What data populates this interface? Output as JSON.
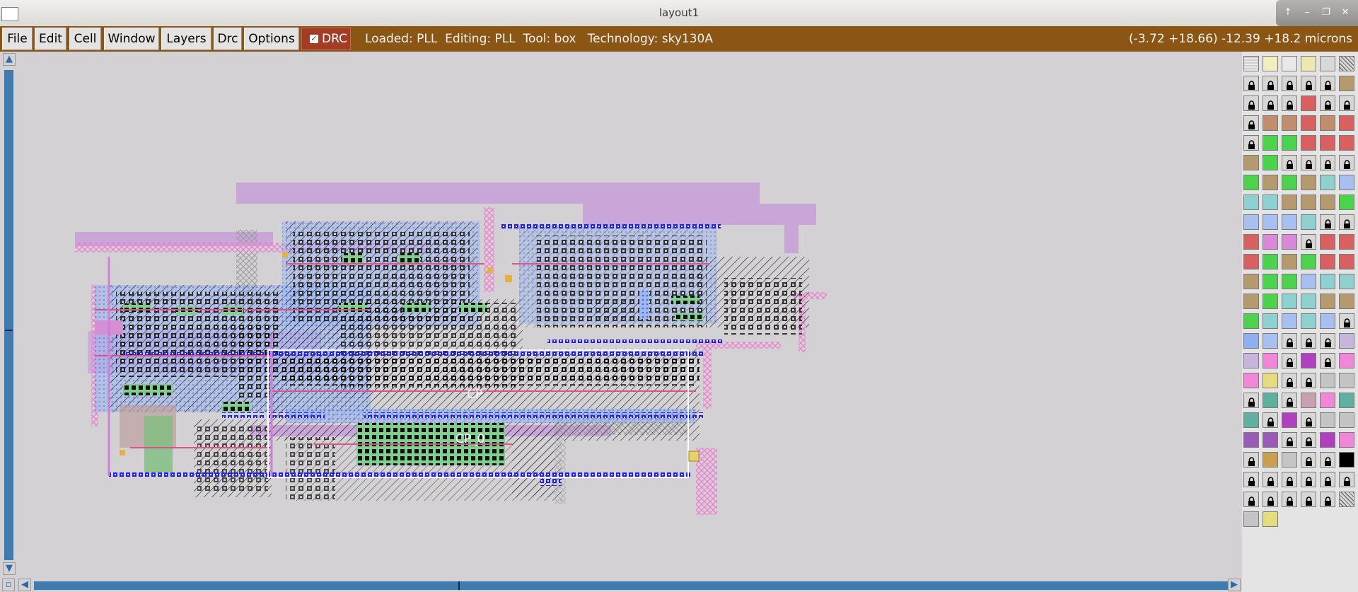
{
  "window": {
    "title": "layout1",
    "controls": [
      "up-icon",
      "minimize-icon",
      "restore-icon",
      "close-icon"
    ]
  },
  "menu": {
    "file": "File",
    "edit": "Edit",
    "cell": "Cell",
    "window": "Window",
    "layers": "Layers",
    "drc_menu": "Drc",
    "options": "Options"
  },
  "drc_toggle": {
    "label": "DRC",
    "checked": true
  },
  "status": {
    "text": "Loaded: PLL  Editing: PLL  Tool: box   Technology: sky130A"
  },
  "coords": {
    "text": "(-3.72 +18.66) -12.39 +18.2 microns"
  },
  "layout": {
    "cell_label": "CP",
    "instance_label": "CP_0"
  },
  "colors": {
    "menubar": "#8b5513",
    "drc": "#a33c27",
    "scroll": "#3f7bb0",
    "canvas": "#d3d1d4",
    "metal1": "#9ab4ea",
    "metal2": "#c8a0d8",
    "li": "#d07fd8",
    "poly": "#e04080",
    "diff": "#50c050",
    "via": "#2020e8"
  },
  "palette": {
    "layers": [
      "grid",
      "pwell",
      "box",
      "nwell",
      "outline",
      "hatch",
      "lock",
      "lock",
      "lock",
      "lock",
      "lock",
      "tan",
      "lock",
      "lock",
      "lock",
      "red",
      "lock",
      "lock",
      "lock",
      "brown",
      "brown",
      "red",
      "brown",
      "red",
      "lock",
      "green",
      "green",
      "red",
      "red",
      "red",
      "tan",
      "green",
      "lock",
      "lock",
      "lock",
      "lock",
      "green",
      "tan",
      "green",
      "tan",
      "cyan",
      "blue",
      "cyan",
      "cyan",
      "tan",
      "tan",
      "tan",
      "green",
      "blue",
      "blue",
      "blue",
      "cyan",
      "lock",
      "lock",
      "red",
      "magenta",
      "magenta",
      "lock",
      "red",
      "red",
      "red",
      "green",
      "tan",
      "green",
      "red",
      "red",
      "tan",
      "green",
      "green",
      "blue",
      "cyan",
      "cyan",
      "tan",
      "green",
      "cyan",
      "cyan",
      "tan",
      "tan",
      "green",
      "cyan",
      "blue",
      "cyan",
      "blue",
      "lock",
      "lblue",
      "blue",
      "lock",
      "lock",
      "lock",
      "lilac",
      "lilac",
      "pink",
      "lock",
      "purple",
      "lock",
      "pink",
      "pink",
      "yellow",
      "lock",
      "lock",
      "grey",
      "grey",
      "lock",
      "teal",
      "lock",
      "mauve",
      "pink",
      "teal",
      "teal",
      "lock",
      "purple",
      "lock",
      "grey",
      "grey",
      "violet",
      "violet",
      "lock",
      "lock",
      "purple",
      "pink",
      "lock",
      "gold",
      "grey",
      "lock",
      "lock",
      "black",
      "lock",
      "lock",
      "lock",
      "lock",
      "lock",
      "lock",
      "lock",
      "lock",
      "lock",
      "lock",
      "lock",
      "hatch",
      "grey",
      "yellow"
    ]
  }
}
